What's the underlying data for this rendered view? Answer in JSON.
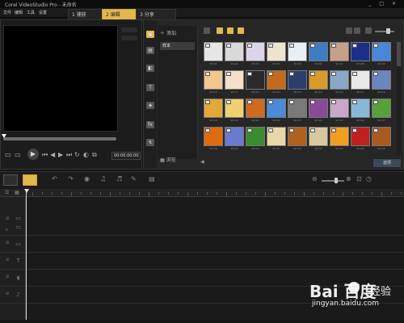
{
  "window": {
    "title": "Corel VideoStudio Pro - 未命名",
    "controls": [
      "_",
      "□",
      "×"
    ]
  },
  "menu": [
    "文件",
    "编辑",
    "工具",
    "设置"
  ],
  "steps": [
    {
      "num": "1",
      "label": "捕获"
    },
    {
      "num": "2",
      "label": "编辑",
      "active": true
    },
    {
      "num": "3",
      "label": "分享"
    }
  ],
  "preview": {
    "timecode": "00:00:00:00"
  },
  "library": {
    "add_label": "添加",
    "folder": "样本",
    "browse_label": "浏览",
    "footer_label": "选项",
    "thumbs": [
      {
        "label": "SP-I01",
        "color": "#e6e6e6"
      },
      {
        "label": "SP-I02",
        "color": "#d9d9d9"
      },
      {
        "label": "SP-I03",
        "color": "#dcd4e8"
      },
      {
        "label": "SP-I04",
        "color": "#ebe5d0"
      },
      {
        "label": "SP-I05",
        "color": "#e8f0f4"
      },
      {
        "label": "SP-I06",
        "color": "#3e7cc4"
      },
      {
        "label": "SP-I07",
        "color": "#c8a08a"
      },
      {
        "label": "SP-I08",
        "color": "#1c2f8c"
      },
      {
        "label": "SP-I09",
        "color": "#4a86d8"
      },
      {
        "label": "SP-I10",
        "color": "#f0c890"
      },
      {
        "label": "SP-I11",
        "color": "#f4e0c8"
      },
      {
        "label": "SP-I12",
        "color": "#2a2a2a"
      },
      {
        "label": "SP-I13",
        "color": "#c46a1a"
      },
      {
        "label": "SP-I14",
        "color": "#2b3f6e"
      },
      {
        "label": "SP-I15",
        "color": "#d89a2a"
      },
      {
        "label": "SP-I16",
        "color": "#8aa6c8"
      },
      {
        "label": "SP-I17",
        "color": "#e8e8e8"
      },
      {
        "label": "SP-I18",
        "color": "#6a86c0"
      },
      {
        "label": "SP-I19",
        "color": "#e2a838"
      },
      {
        "label": "SP-I20",
        "color": "#f0d070"
      },
      {
        "label": "SP-I21",
        "color": "#d06a20"
      },
      {
        "label": "SP-I22",
        "color": "#4a8ad8"
      },
      {
        "label": "SP-I23",
        "color": "#7a7a7a"
      },
      {
        "label": "SP-I24",
        "color": "#8a4a9a"
      },
      {
        "label": "SP-I25",
        "color": "#c8a8c8"
      },
      {
        "label": "SP-I26",
        "color": "#88b8d8"
      },
      {
        "label": "SP-I27",
        "color": "#5aa03a"
      },
      {
        "label": "SP-I28",
        "color": "#e06a10"
      },
      {
        "label": "SP-I29",
        "color": "#6a7ad0"
      },
      {
        "label": "SP-I30",
        "color": "#3a8a30"
      },
      {
        "label": "SP-I31",
        "color": "#e8d8a8"
      },
      {
        "label": "SP-I32",
        "color": "#b06020"
      },
      {
        "label": "SP-I33",
        "color": "#d8c8a0"
      },
      {
        "label": "SP-I34",
        "color": "#f0a020"
      },
      {
        "label": "SP-I35",
        "color": "#c02020"
      },
      {
        "label": "SP-I36",
        "color": "#a85a20"
      }
    ]
  },
  "watermark": {
    "logo": "Bai 百度",
    "cn": "经验",
    "url": "jingyan.baidu.com"
  }
}
